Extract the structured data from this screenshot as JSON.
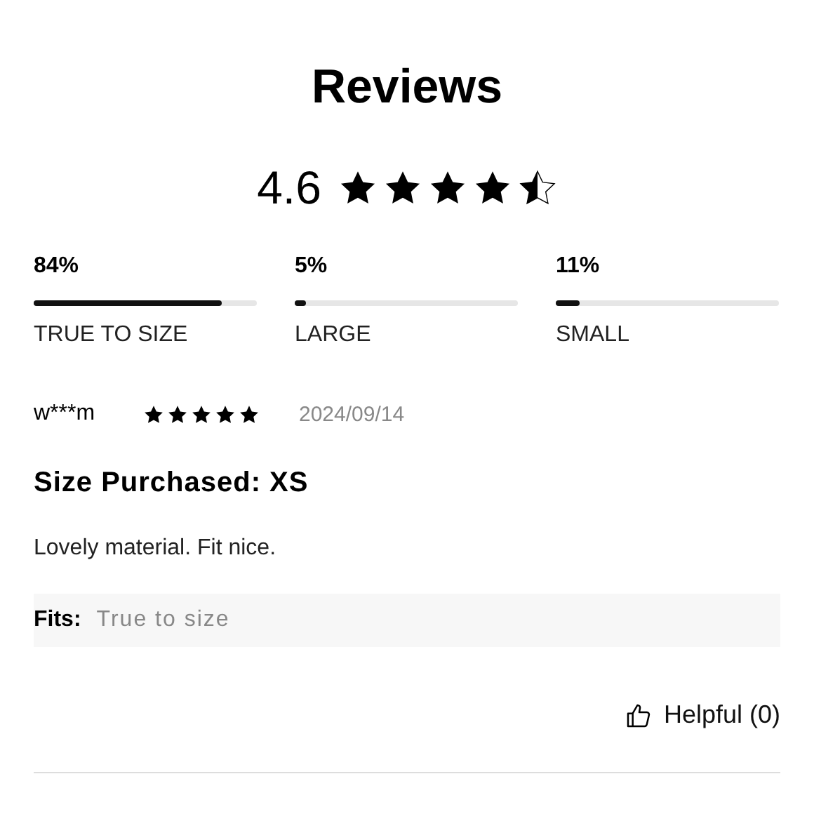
{
  "title": "Reviews",
  "summary": {
    "rating": "4.6",
    "stars": 4.5
  },
  "fit": [
    {
      "percent": "84%",
      "level": 0.84,
      "label": "TRUE TO SIZE"
    },
    {
      "percent": "5%",
      "level": 0.05,
      "label": "LARGE"
    },
    {
      "percent": "11%",
      "level": 0.11,
      "label": "SMALL"
    }
  ],
  "reviews": [
    {
      "user": "w***m",
      "stars": 5,
      "date": "2024/09/14",
      "size": "Size Purchased: XS",
      "text": "Lovely material. Fit nice.",
      "fits_label": "Fits:",
      "fits_value": "True to size",
      "helpful": "Helpful (0)"
    }
  ]
}
